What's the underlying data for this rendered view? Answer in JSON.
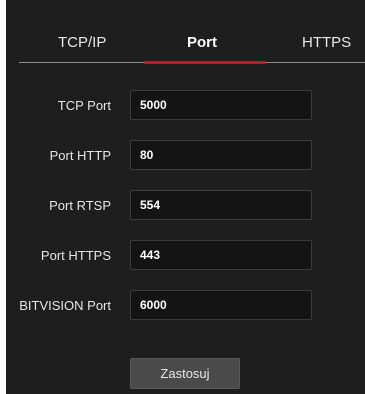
{
  "tabs": [
    {
      "label": "TCP/IP",
      "active": false
    },
    {
      "label": "Port",
      "active": true
    },
    {
      "label": "HTTPS",
      "active": false
    }
  ],
  "accent_color": "#b0212a",
  "fields": [
    {
      "label": "TCP Port",
      "value": "5000"
    },
    {
      "label": "Port HTTP",
      "value": "80"
    },
    {
      "label": "Port RTSP",
      "value": "554"
    },
    {
      "label": "Port HTTPS",
      "value": "443"
    },
    {
      "label": "BITVISION Port",
      "value": "6000"
    }
  ],
  "apply_label": "Zastosuj"
}
